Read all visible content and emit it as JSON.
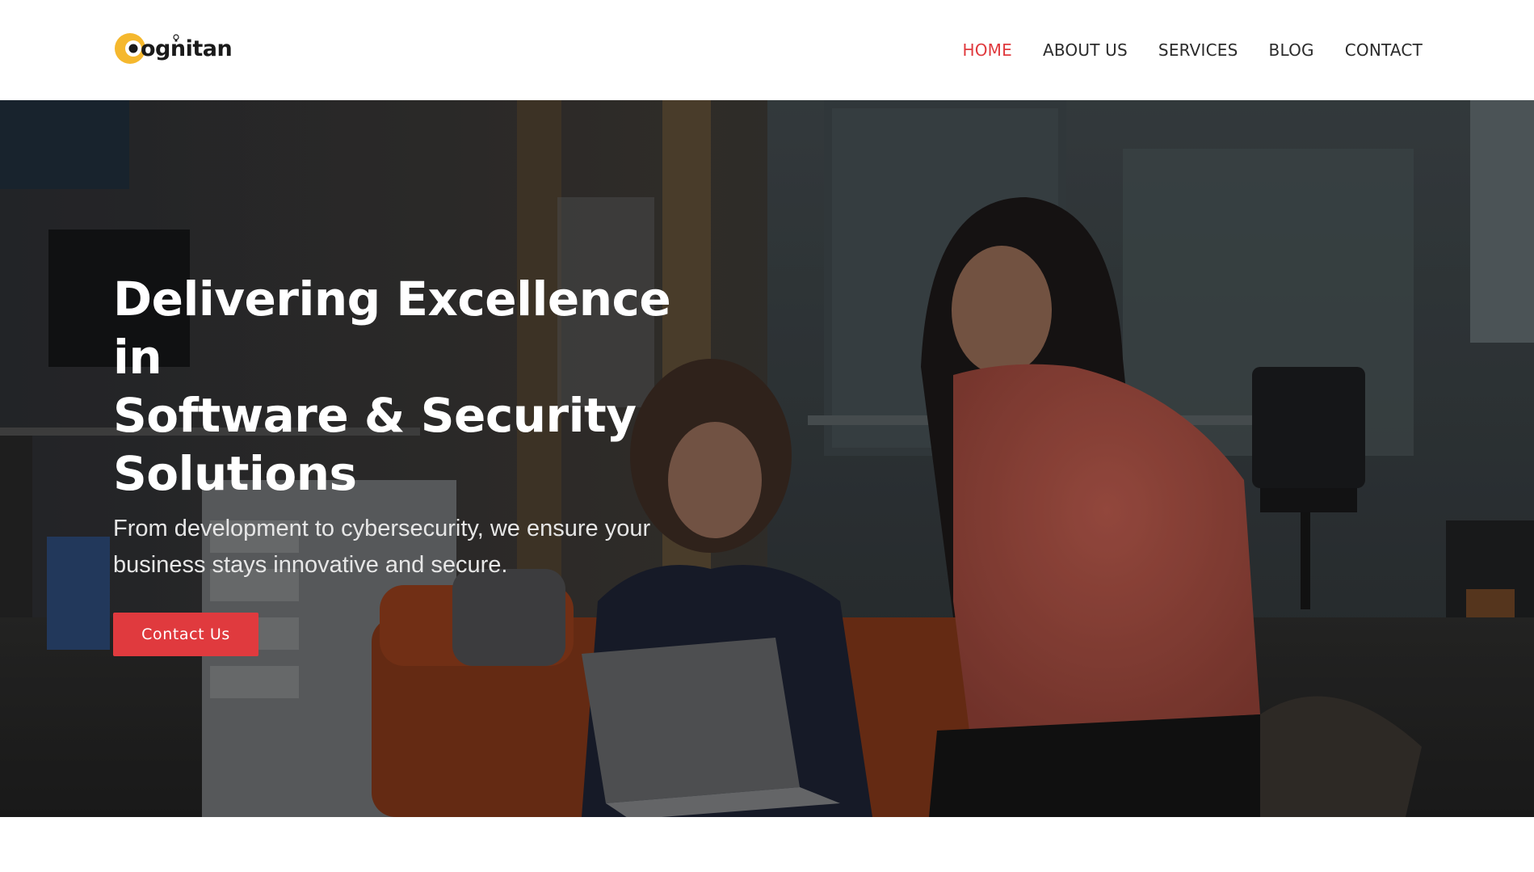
{
  "brand": {
    "name": "ognitan",
    "logo_icon": "cognitan-logo-circle-c",
    "accent_color": "#f5b82e"
  },
  "nav": {
    "items": [
      {
        "label": "HOME",
        "active": true
      },
      {
        "label": "ABOUT US",
        "active": false
      },
      {
        "label": "SERVICES",
        "active": false
      },
      {
        "label": "BLOG",
        "active": false
      },
      {
        "label": "CONTACT",
        "active": false
      }
    ],
    "active_color": "#e03a3e"
  },
  "hero": {
    "title_lines": [
      "Delivering Excellence in",
      "Software & Security",
      "Solutions"
    ],
    "subtitle_lines": [
      "From development to cybersecurity, we ensure your",
      "business stays innovative and secure."
    ],
    "cta_label": "Contact Us",
    "cta_color": "#e03a3e",
    "background_image": "office-two-women-laptop-photo"
  }
}
